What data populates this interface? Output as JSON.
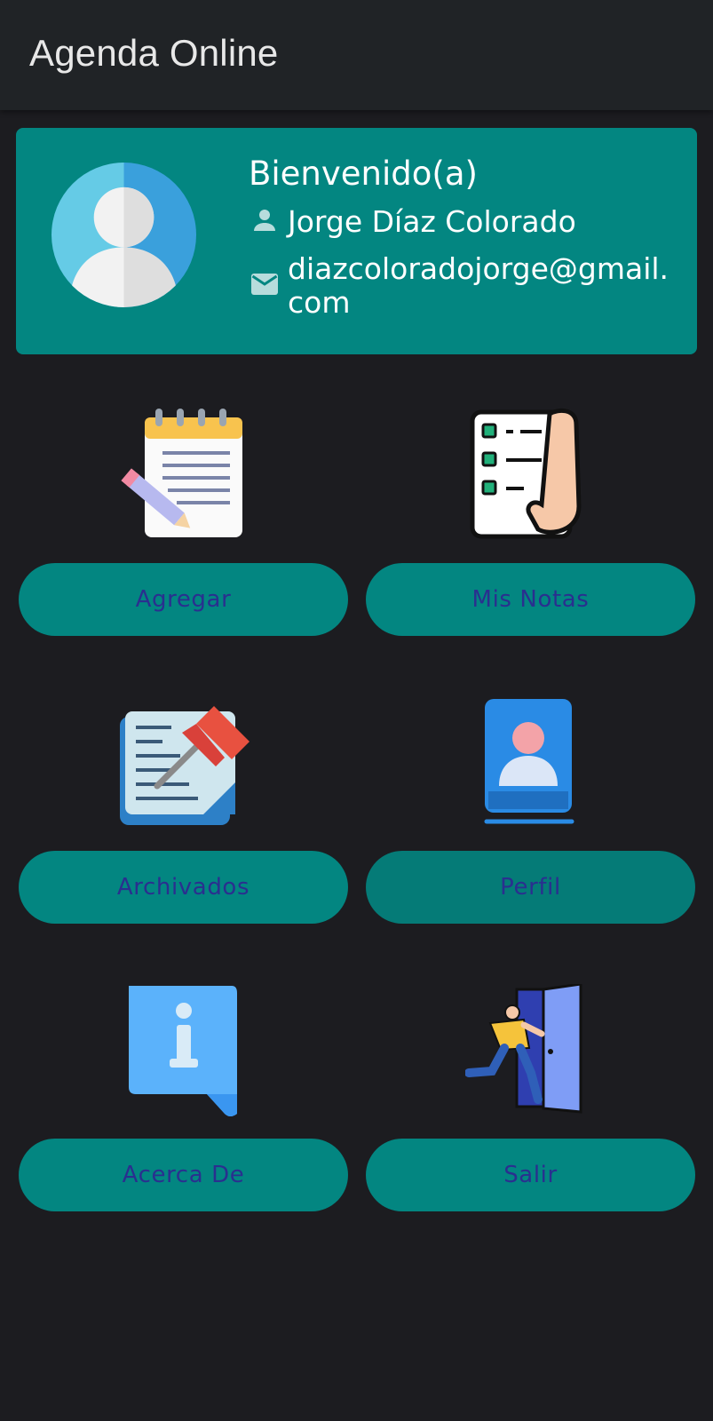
{
  "appbar": {
    "title": "Agenda Online"
  },
  "profile": {
    "welcome": "Bienvenido(a)",
    "name": "Jorge Díaz Colorado",
    "email": "diazcoloradojorge@gmail.com"
  },
  "menu": {
    "agregar": "Agregar",
    "mis_notas": "Mis Notas",
    "archivados": "Archivados",
    "perfil": "Perfil",
    "acerca_de": "Acerca De",
    "salir": "Salir"
  },
  "icons": {
    "avatar": "avatar-icon",
    "person": "person-icon",
    "email": "email-icon",
    "agregar": "notepad-pencil-icon",
    "mis_notas": "checklist-hand-icon",
    "archivados": "pinned-note-icon",
    "perfil": "contact-book-icon",
    "acerca_de": "info-icon",
    "salir": "exit-door-icon"
  },
  "colors": {
    "background": "#1c1c20",
    "appbar": "#202326",
    "accent": "#038681",
    "button_text": "#2a2f8f"
  }
}
